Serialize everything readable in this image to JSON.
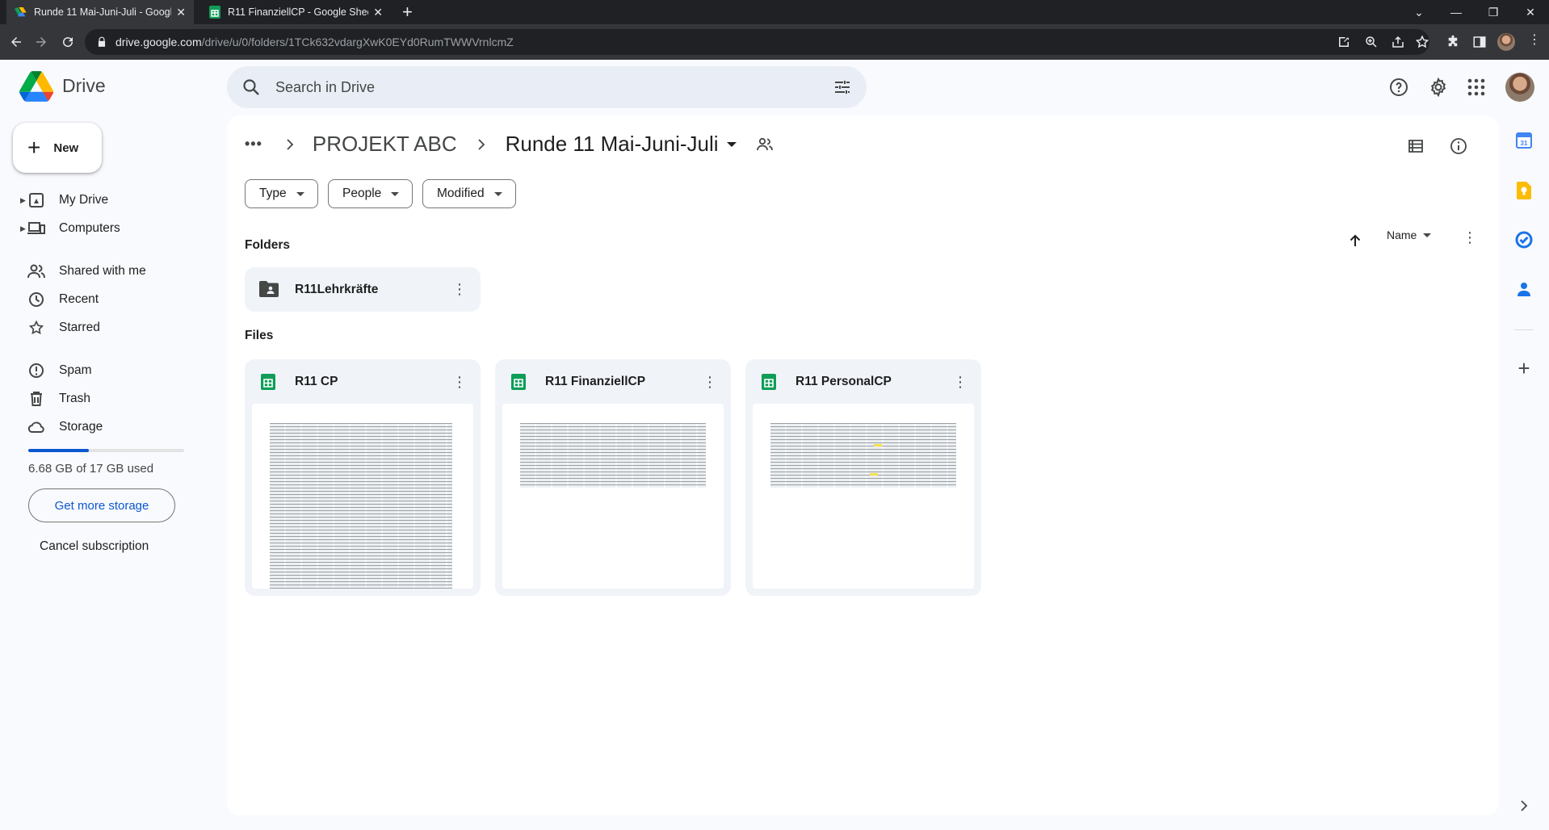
{
  "browser": {
    "tabs": [
      {
        "title": "Runde 11 Mai-Juni-Juli - Google",
        "active": true,
        "icon": "drive-icon"
      },
      {
        "title": "R11 FinanziellCP - Google Sheet",
        "active": false,
        "icon": "sheets-icon"
      }
    ],
    "url_domain": "drive.google.com",
    "url_path": "/drive/u/0/folders/1TCk632vdargXwK0EYd0RumTWWVrnlcmZ"
  },
  "app": {
    "name": "Drive"
  },
  "search": {
    "placeholder": "Search in Drive"
  },
  "sidebar": {
    "new_label": "New",
    "items": [
      {
        "label": "My Drive",
        "icon": "my-drive-icon"
      },
      {
        "label": "Computers",
        "icon": "computers-icon"
      },
      {
        "label": "Shared with me",
        "icon": "shared-icon"
      },
      {
        "label": "Recent",
        "icon": "clock-icon"
      },
      {
        "label": "Starred",
        "icon": "star-icon"
      },
      {
        "label": "Spam",
        "icon": "spam-icon"
      },
      {
        "label": "Trash",
        "icon": "trash-icon"
      },
      {
        "label": "Storage",
        "icon": "cloud-icon"
      }
    ],
    "storage_used_text": "6.68 GB of 17 GB used",
    "storage_fraction": 0.39,
    "get_more_label": "Get more storage",
    "cancel_label": "Cancel subscription"
  },
  "breadcrumb": {
    "overflow": "•••",
    "parent": "PROJEKT ABC",
    "current": "Runde 11 Mai-Juni-Juli"
  },
  "filters": {
    "type": "Type",
    "people": "People",
    "modified": "Modified"
  },
  "sort": {
    "label": "Name"
  },
  "sections": {
    "folders": "Folders",
    "files": "Files"
  },
  "folders": [
    {
      "name": "R11Lehrkräfte"
    }
  ],
  "files": [
    {
      "name": "R11 CP"
    },
    {
      "name": "R11 FinanziellCP"
    },
    {
      "name": "R11 PersonalCP"
    }
  ],
  "colors": {
    "accent": "#0b57d0",
    "sheets_green": "#0f9d58",
    "panel": "#ffffff",
    "background": "#f8fafd"
  }
}
